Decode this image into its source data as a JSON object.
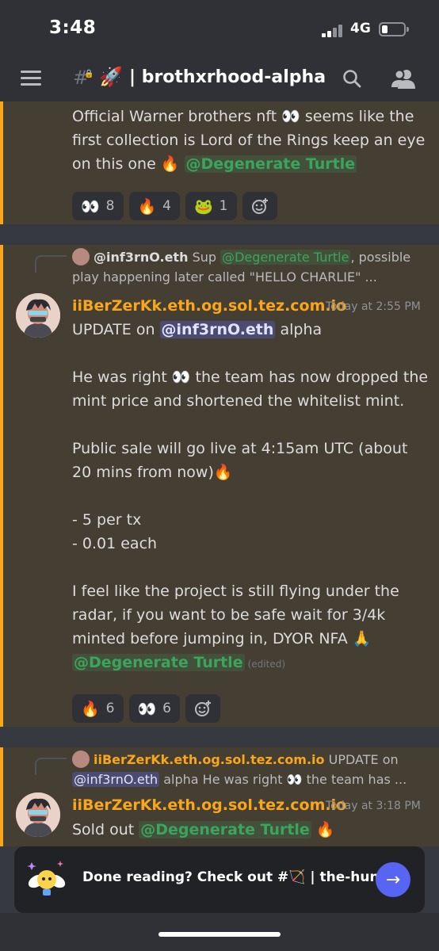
{
  "status_bar": {
    "time": "3:48",
    "network": "4G"
  },
  "header": {
    "hash": "#",
    "emoji": "🚀",
    "channel_name": "| brothxrhood-alpha"
  },
  "messages": [
    {
      "lines": [
        "Official Warner brothers nft 👀 seems like the",
        "first collection is Lord of the Rings keep an eye",
        "on this one 🔥"
      ],
      "mention": "@Degenerate Turtle",
      "reactions": [
        {
          "emoji": "👀",
          "count": "8"
        },
        {
          "emoji": "🔥",
          "count": "4"
        },
        {
          "emoji": "🐸",
          "count": "1"
        }
      ]
    },
    {
      "reply": {
        "author": "@inf3rnO.eth",
        "text_1": "Sup",
        "mention": "@Degenerate Turtle",
        "text_2": ", possible",
        "line_2": "play happening later called \"HELLO CHARLIE\"  ..."
      },
      "author": "iiBerZerKk.eth.og.sol.tez.com.io",
      "timestamp": "Today at 2:55 PM",
      "first_line_pre": "UPDATE on",
      "first_line_mention": "@inf3rnO.eth",
      "first_line_post": "alpha",
      "paragraphs": [
        "He was right 👀 the team has now dropped the",
        "mint price and shortened the whitelist mint.",
        "Public sale will go live at 4:15am UTC (about",
        "20 mins from now)🔥",
        "- 5 per tx",
        "- 0.01 each",
        "I feel like the project is still flying under the",
        "radar, if you want to be safe wait for 3/4k",
        "minted before jumping in, DYOR NFA 🙏"
      ],
      "mention": "@Degenerate Turtle",
      "edited": "(edited)",
      "reactions": [
        {
          "emoji": "🔥",
          "count": "6"
        },
        {
          "emoji": "👀",
          "count": "6"
        }
      ]
    },
    {
      "reply": {
        "author": "iiBerZerKk.eth.og.sol.tez.com.io",
        "text_1": "UPDATE on",
        "line_2_mention": "@inf3rnO.eth",
        "line_2": "alpha   He was right 👀 the team has ..."
      },
      "author": "iiBerZerKk.eth.og.sol.tez.com.io",
      "timestamp": "Today at 3:18 PM",
      "text": "Sold out",
      "mention": "@Degenerate Turtle",
      "emoji": "🔥"
    }
  ],
  "banner": {
    "text": "Done reading? Check out #🏹 | the-hunt.",
    "button": "→"
  }
}
